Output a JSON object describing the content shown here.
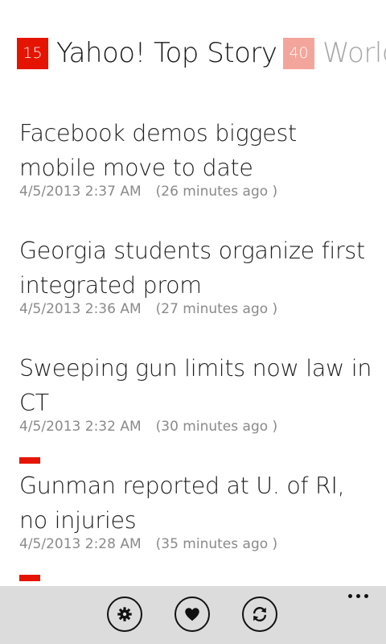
{
  "pivot": {
    "items": [
      {
        "count": "15",
        "title": "Yahoo! Top Story"
      },
      {
        "count": "40",
        "title": "World"
      }
    ]
  },
  "stories": [
    {
      "title_line1": "Facebook demos biggest",
      "title_line2": "mobile move to date",
      "timestamp": "4/5/2013 2:37 AM",
      "ago": "(26 minutes ago )"
    },
    {
      "title_line1": "Georgia students organize first",
      "title_line2": "integrated prom",
      "timestamp": "4/5/2013 2:36 AM",
      "ago": "(27 minutes ago )"
    },
    {
      "title_line1": "Sweeping gun limits now law in",
      "title_line2": "CT",
      "timestamp": "4/5/2013 2:32 AM",
      "ago": "(30 minutes ago )"
    },
    {
      "title_line1": "Gunman reported at U. of RI,",
      "title_line2": "no injuries",
      "timestamp": "4/5/2013 2:28 AM",
      "ago": "(35 minutes ago )"
    }
  ],
  "appbar": {
    "buttons": [
      "settings-icon",
      "heart-icon",
      "refresh-icon"
    ],
    "more": "more-icon"
  },
  "colors": {
    "accent": "#e51400",
    "accent_faded": "#f4a59b",
    "appbar_bg": "#dcdcdc"
  }
}
